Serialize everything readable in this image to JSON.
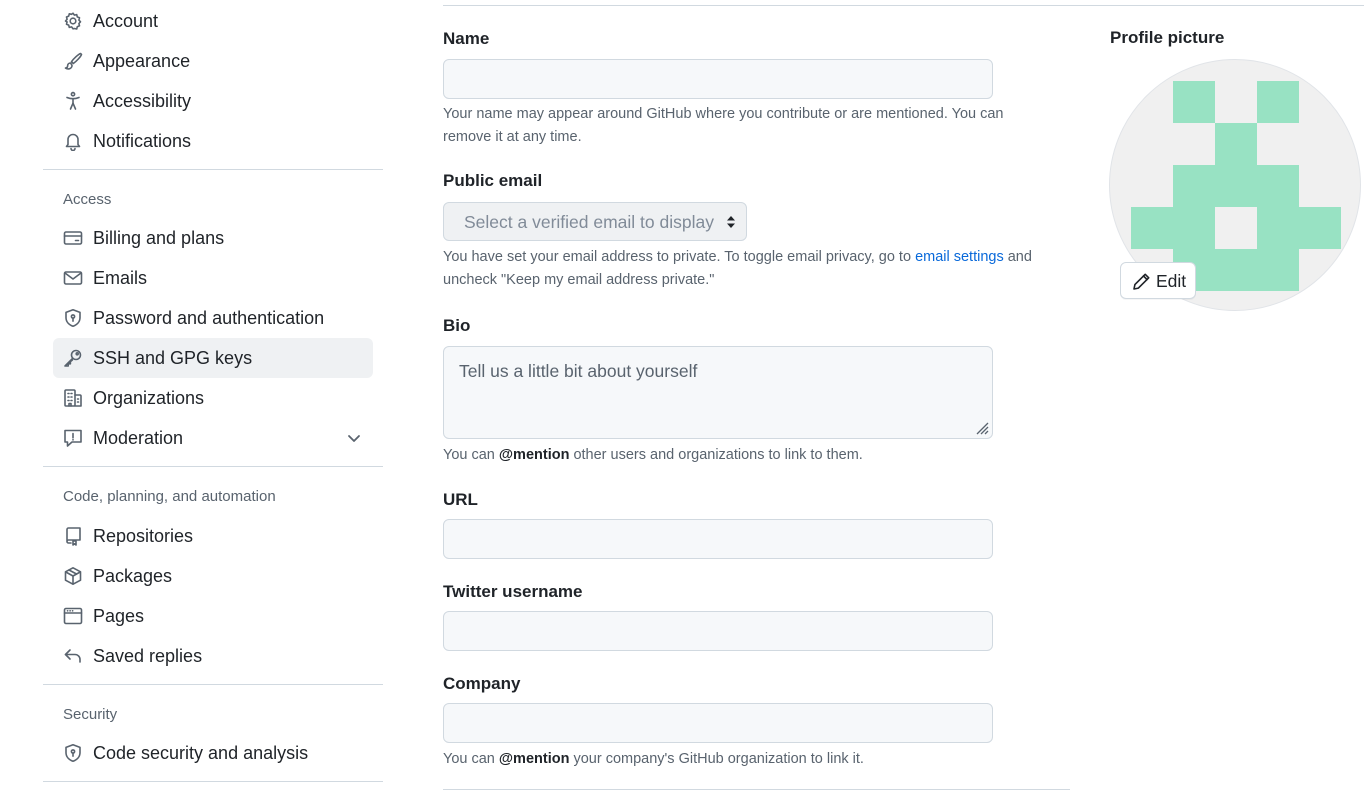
{
  "sidebar": {
    "items_top": [
      {
        "label": "Account",
        "icon": "gear-icon"
      },
      {
        "label": "Appearance",
        "icon": "paintbrush-icon"
      },
      {
        "label": "Accessibility",
        "icon": "accessibility-icon"
      },
      {
        "label": "Notifications",
        "icon": "bell-icon"
      }
    ],
    "access_heading": "Access",
    "access_items": [
      {
        "label": "Billing and plans",
        "icon": "credit-card-icon"
      },
      {
        "label": "Emails",
        "icon": "mail-icon"
      },
      {
        "label": "Password and authentication",
        "icon": "shield-lock-icon"
      },
      {
        "label": "SSH and GPG keys",
        "icon": "key-icon",
        "active": true
      },
      {
        "label": "Organizations",
        "icon": "organization-icon"
      },
      {
        "label": "Moderation",
        "icon": "report-icon",
        "expandable": true
      }
    ],
    "code_heading": "Code, planning, and automation",
    "code_items": [
      {
        "label": "Repositories",
        "icon": "repo-icon"
      },
      {
        "label": "Packages",
        "icon": "package-icon"
      },
      {
        "label": "Pages",
        "icon": "browser-icon"
      },
      {
        "label": "Saved replies",
        "icon": "reply-icon"
      }
    ],
    "security_heading": "Security",
    "security_items": [
      {
        "label": "Code security and analysis",
        "icon": "shield-lock-icon"
      }
    ]
  },
  "form": {
    "name_label": "Name",
    "name_value": "",
    "name_hint": "Your name may appear around GitHub where you contribute or are mentioned. You can remove it at any time.",
    "email_label": "Public email",
    "email_select": "Select a verified email to display",
    "email_hint_before": "You have set your email address to private. To toggle email privacy, go to ",
    "email_hint_link": "email settings",
    "email_hint_after": " and uncheck \"Keep my email address private.\"",
    "bio_label": "Bio",
    "bio_placeholder": "Tell us a little bit about yourself",
    "bio_hint_before": "You can ",
    "bio_hint_mention": "@mention",
    "bio_hint_after": " other users and organizations to link to them.",
    "url_label": "URL",
    "url_value": "",
    "twitter_label": "Twitter username",
    "twitter_value": "",
    "company_label": "Company",
    "company_value": "",
    "company_hint_before": "You can ",
    "company_hint_mention": "@mention",
    "company_hint_after": " your company's GitHub organization to link it."
  },
  "profile_picture": {
    "title": "Profile picture",
    "edit_label": "Edit",
    "avatar_color": "#98e2c3",
    "avatar_bg": "#f0f0f0"
  },
  "colors": {
    "link": "#0969da",
    "muted": "#59636e",
    "active_bg": "#eff1f3"
  }
}
